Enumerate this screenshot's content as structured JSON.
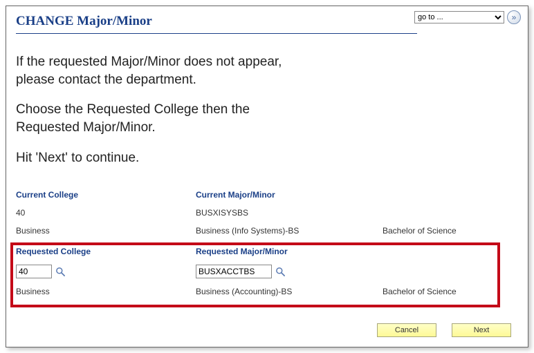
{
  "header": {
    "title": "CHANGE Major/Minor",
    "goto_label": "go to ..."
  },
  "instructions": {
    "p1a": "If the requested Major/Minor does not appear,",
    "p1b": "please contact the department.",
    "p2a": "Choose the Requested College then the",
    "p2b": "Requested Major/Minor.",
    "p3": "Hit 'Next' to continue."
  },
  "current": {
    "college_hdr": "Current College",
    "major_hdr": "Current Major/Minor",
    "college_code": "40",
    "major_code": "BUSXISYSBS",
    "college_name": "Business",
    "major_name": "Business (Info Systems)-BS",
    "degree": "Bachelor of Science"
  },
  "requested": {
    "college_hdr": "Requested College",
    "major_hdr": "Requested Major/Minor",
    "college_code": "40",
    "major_code": "BUSXACCTBS",
    "college_name": "Business",
    "major_name": "Business (Accounting)-BS",
    "degree": "Bachelor of Science"
  },
  "buttons": {
    "cancel": "Cancel",
    "next": "Next"
  }
}
